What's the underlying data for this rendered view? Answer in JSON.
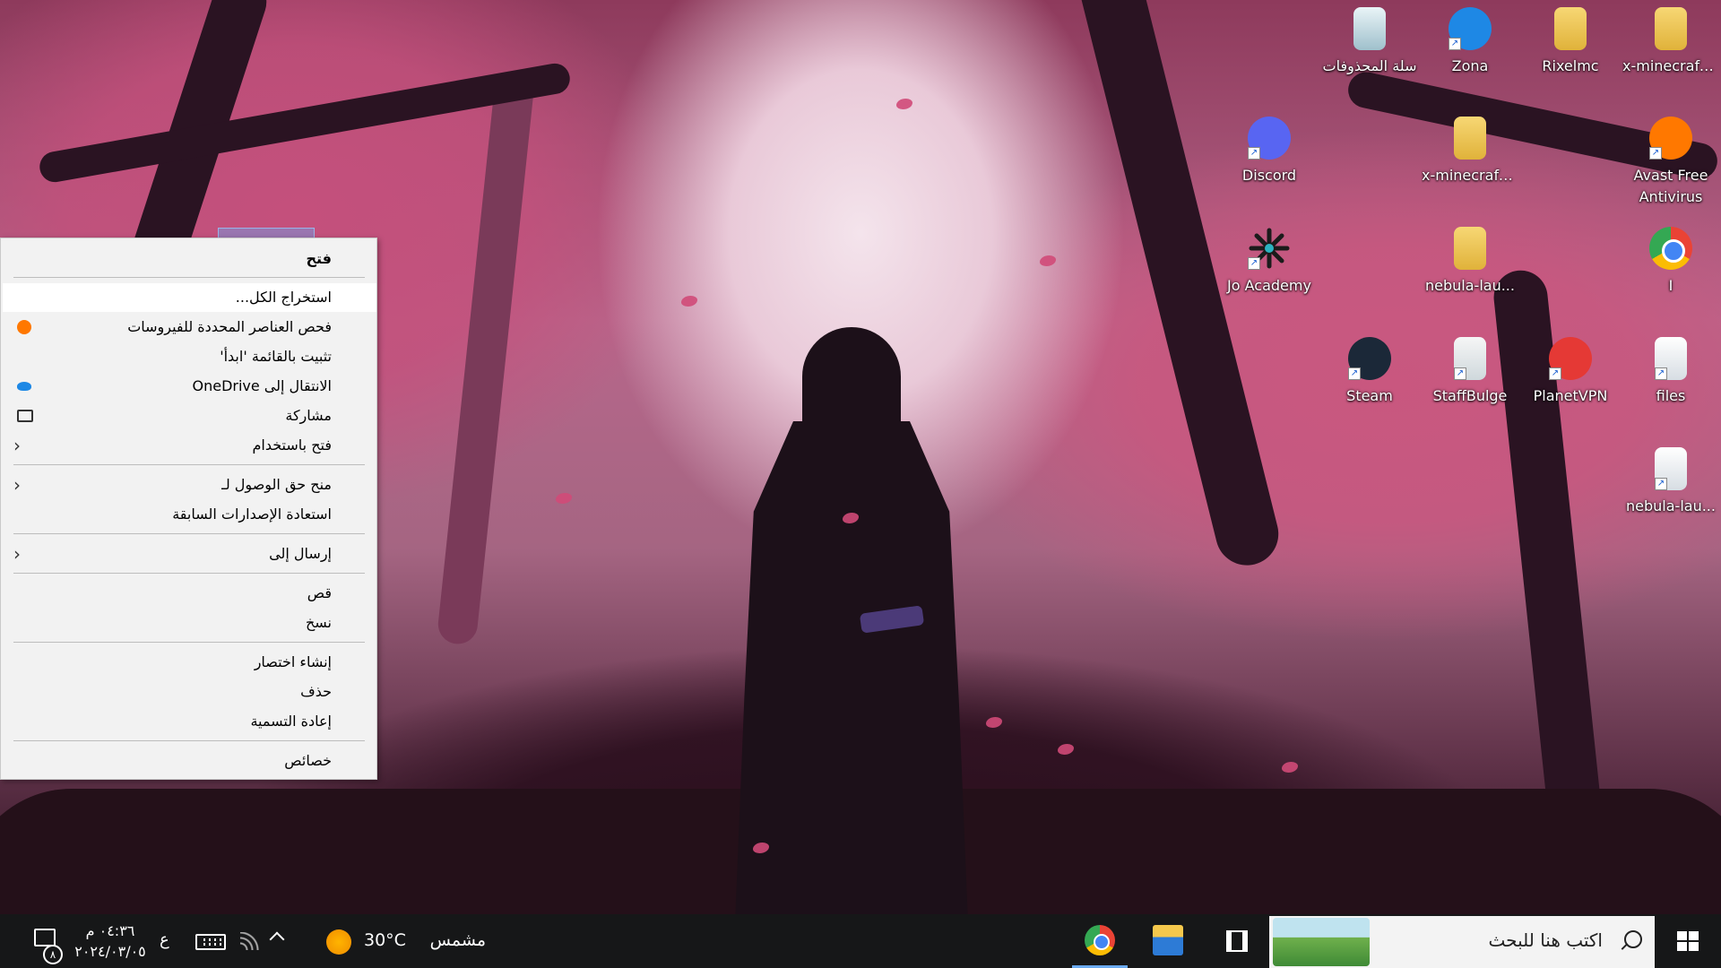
{
  "desktop_icons": [
    {
      "label": "سلة المحذوفات",
      "icon": "recycle-bin-icon"
    },
    {
      "label": "Zona",
      "icon": "zona-icon"
    },
    {
      "label": "Rixelmc",
      "icon": "zip-folder-icon"
    },
    {
      "label": "x-minecraft-...",
      "icon": "zip-folder-icon"
    },
    {
      "label": "Discord",
      "icon": "discord-icon"
    },
    {
      "label": "x-minecraft-...",
      "icon": "zip-folder-icon"
    },
    {
      "label": "Avast Free Antivirus",
      "icon": "avast-icon"
    },
    {
      "label": "Jo Academy",
      "icon": "jo-academy-icon"
    },
    {
      "label": "nebula-lau...",
      "icon": "zip-folder-icon"
    },
    {
      "label": "I",
      "icon": "chrome-icon"
    },
    {
      "label": "Steam",
      "icon": "steam-icon"
    },
    {
      "label": "StaffBulge",
      "icon": "staffbulge-icon"
    },
    {
      "label": "PlanetVPN",
      "icon": "planetvpn-icon"
    },
    {
      "label": "files",
      "icon": "excel-file-icon"
    },
    {
      "label": "nebula-lau...",
      "icon": "file-icon"
    }
  ],
  "context_menu": {
    "items": [
      {
        "label": "فتح",
        "bold": true
      },
      {
        "label": "استخراج الكل...",
        "highlighted": true
      },
      {
        "label": "فحص العناصر المحددة للفيروسات",
        "icon": "avast-icon"
      },
      {
        "label": "تثبيت بالقائمة 'ابدأ'"
      },
      {
        "label": "الانتقال إلى OneDrive",
        "icon": "onedrive-icon"
      },
      {
        "label": "مشاركة",
        "icon": "share-icon"
      },
      {
        "label": "فتح باستخدام",
        "submenu": true
      },
      {
        "label": "منح حق الوصول لـ",
        "submenu": true
      },
      {
        "label": "استعادة الإصدارات السابقة"
      },
      {
        "label": "إرسال إلى",
        "submenu": true
      },
      {
        "label": "قص"
      },
      {
        "label": "نسخ"
      },
      {
        "label": "إنشاء اختصار"
      },
      {
        "label": "حذف"
      },
      {
        "label": "إعادة التسمية"
      },
      {
        "label": "خصائص"
      }
    ]
  },
  "taskbar": {
    "search_placeholder": "اكتب هنا للبحث",
    "pinned_apps": [
      {
        "name": "File Explorer",
        "icon": "file-explorer-icon"
      },
      {
        "name": "Google Chrome",
        "icon": "chrome-icon",
        "active": true
      }
    ],
    "weather": {
      "temperature": "30°C",
      "condition": "مشمس",
      "icon": "sun-icon"
    },
    "language": "ع",
    "clock": {
      "time": "٠٤:٣٦ م",
      "date": "٢٠٢٤/٠٣/٠٥"
    },
    "notification_count": "٨"
  }
}
